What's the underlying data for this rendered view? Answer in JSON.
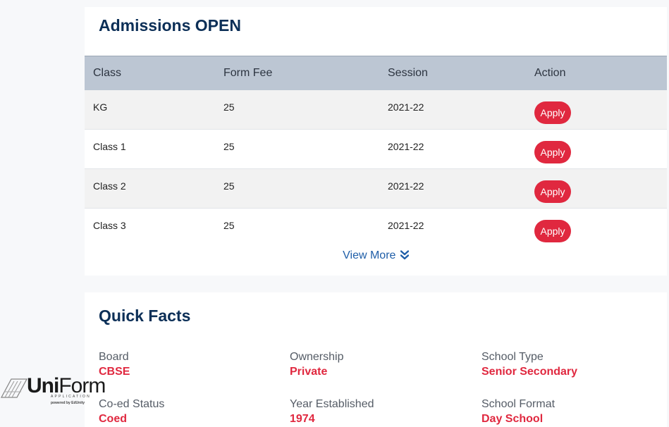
{
  "admissions": {
    "title": "Admissions OPEN",
    "columns": [
      "Class",
      "Form Fee",
      "Session",
      "Action"
    ],
    "rows": [
      {
        "class": "KG",
        "fee": "25",
        "session": "2021-22",
        "action": "Apply"
      },
      {
        "class": "Class 1",
        "fee": "25",
        "session": "2021-22",
        "action": "Apply"
      },
      {
        "class": "Class 2",
        "fee": "25",
        "session": "2021-22",
        "action": "Apply"
      },
      {
        "class": "Class 3",
        "fee": "25",
        "session": "2021-22",
        "action": "Apply"
      }
    ],
    "view_more": "View More"
  },
  "quick_facts": {
    "title": "Quick Facts",
    "facts": [
      {
        "label": "Board",
        "value": "CBSE"
      },
      {
        "label": "Ownership",
        "value": "Private"
      },
      {
        "label": "School Type",
        "value": "Senior Secondary"
      },
      {
        "label": "Co-ed Status",
        "value": "Coed"
      },
      {
        "label": "Year Established",
        "value": "1974"
      },
      {
        "label": "School Format",
        "value": "Day School"
      }
    ]
  },
  "logo": {
    "uni": "Uni",
    "form": "Form",
    "subtitle": "APPLICATION",
    "powered": "powered by EdUnity"
  },
  "colors": {
    "title": "#0c2f57",
    "accent": "#e0283f",
    "header_bg": "#bcc6d3",
    "link": "#1f5ea8"
  }
}
